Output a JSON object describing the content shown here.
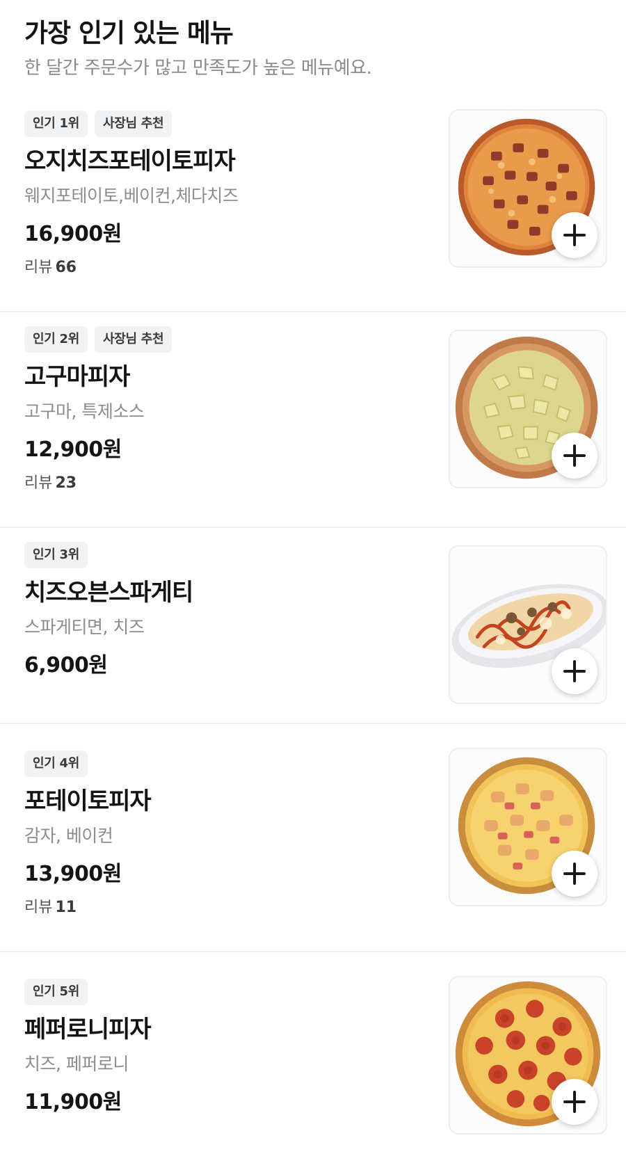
{
  "section": {
    "title": "가장 인기 있는 메뉴",
    "subtitle": "한 달간 주문수가 많고 만족도가 높은 메뉴예요."
  },
  "review_label": "리뷰",
  "items": [
    {
      "badges": [
        "인기 1위",
        "사장님 추천"
      ],
      "name": "오지치즈포테이토피자",
      "description": "웨지포테이토,베이컨,체다치즈",
      "price": "16,900원",
      "reviews": "66",
      "image_icon": "pizza-bacon-image"
    },
    {
      "badges": [
        "인기 2위",
        "사장님 추천"
      ],
      "name": "고구마피자",
      "description": "고구마, 특제소스",
      "price": "12,900원",
      "reviews": "23",
      "image_icon": "pizza-sweet-potato-image"
    },
    {
      "badges": [
        "인기 3위"
      ],
      "name": "치즈오븐스파게티",
      "description": "스파게티면, 치즈",
      "price": "6,900원",
      "image_icon": "spaghetti-image"
    },
    {
      "badges": [
        "인기 4위"
      ],
      "name": "포테이토피자",
      "description": "감자, 베이컨",
      "price": "13,900원",
      "reviews": "11",
      "image_icon": "pizza-potato-image"
    },
    {
      "badges": [
        "인기 5위"
      ],
      "name": "페퍼로니피자",
      "description": "치즈, 페퍼로니",
      "price": "11,900원",
      "image_icon": "pizza-pepperoni-image"
    }
  ],
  "add_icon": "plus-icon",
  "colors": {
    "text": "#141414",
    "muted": "#8c8c8c",
    "badge_bg": "#f1f2f4",
    "divider": "#f1f1f3"
  }
}
